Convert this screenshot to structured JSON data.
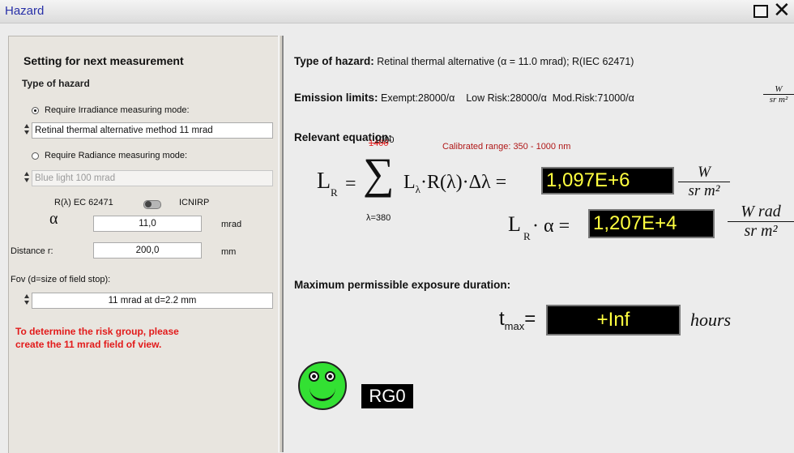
{
  "window": {
    "title": "Hazard",
    "maximize_icon": "square-icon",
    "close_icon": "x-icon"
  },
  "settings": {
    "heading": "Setting for next measurement",
    "type_label": "Type of hazard",
    "irradiance_radio": "Require Irradiance measuring mode:",
    "irradiance_value": "Retinal thermal alternative method 11 mrad",
    "radiance_radio": "Require Radiance measuring mode:",
    "radiance_value": "Blue light 100 mrad",
    "toggle_left": "R(λ) EC 62471",
    "toggle_right": "ICNIRP",
    "alpha_symbol": "α",
    "alpha_value": "11,0",
    "alpha_unit": "mrad",
    "distance_label": "Distance r:",
    "distance_value": "200,0",
    "distance_unit": "mm",
    "fov_label": "Fov (d=size of field stop):",
    "fov_value": "11 mrad at d=2.2 mm",
    "warning_line1": "To determine the risk group, please",
    "warning_line2": "create the 11 mrad field of view."
  },
  "results": {
    "type_label": "Type of hazard:",
    "type_value": "Retinal thermal alternative (α = 11.0 mrad); R(IEC 62471)",
    "limits_label": "Emission limits:",
    "limits_value": "Exempt:28000/α    Low Risk:28000/α  Mod.Risk:71000/α",
    "limits_unit_num": "W",
    "limits_unit_den": "sr m²",
    "equation_label": "Relevant equation:",
    "calibrated_range": "Calibrated range: 350 - 1000 nm",
    "sum_upper": "1000",
    "sum_upper_struck": "1400",
    "sum_lower": "λ=380",
    "lr_value": "1,097E+6",
    "lr_unit_num": "W",
    "lr_unit_den": "sr m²",
    "lra_value": "1,207E+4",
    "lra_unit_num": "W rad",
    "lra_unit_den": "sr m²",
    "mpe_label": "Maximum permissible exposure duration:",
    "tmax_value": "+Inf",
    "tmax_unit": "hours",
    "risk_group": "RG0",
    "smiley_icon": "green-smiley-icon"
  }
}
